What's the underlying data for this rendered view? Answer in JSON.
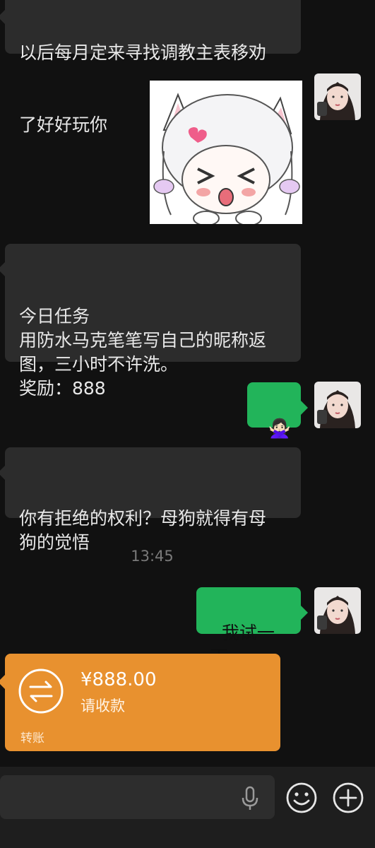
{
  "messages": {
    "top_partial_line1": "以后每月定来寻找调教主表移劝",
    "top_partial_line2": "了好好玩你",
    "task_text": "今日任务\n用防水马克笔笔写自己的昵称返\n图，三小时不许洗。\n奖励：888",
    "gesture_emoji": "🙅🏻‍♀️",
    "reply_text": "你有拒绝的权利？母狗就得有母\n狗的觉悟",
    "timestamp": "13:45",
    "my_reply": "我试一下"
  },
  "transfer": {
    "amount": "¥888.00",
    "subtitle": "请收款",
    "footer": "转账"
  },
  "icons": {
    "sticker": "anime-cat-girl-sticker",
    "avatar": "user-avatar",
    "transfer": "transfer-arrows-icon",
    "mic": "microphone-icon",
    "emoji": "emoji-icon",
    "plus": "plus-icon"
  },
  "colors": {
    "background": "#111111",
    "bubble": "#2c2c2c",
    "green": "#22b45a",
    "transfer": "#e8912f"
  }
}
